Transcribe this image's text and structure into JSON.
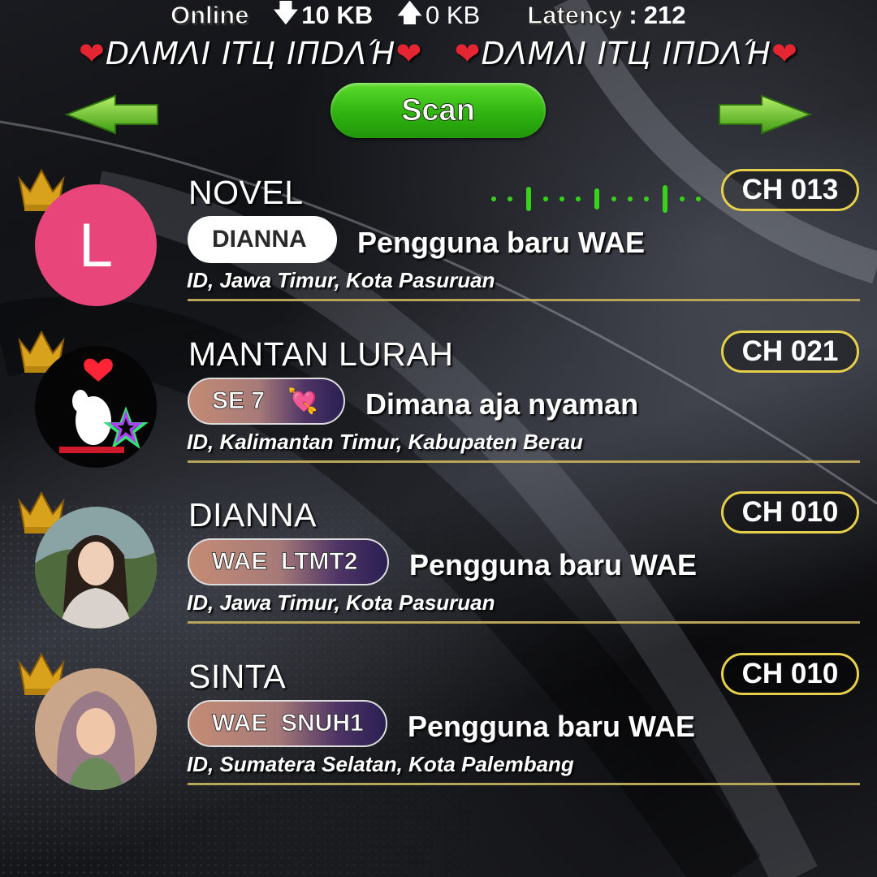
{
  "stats": {
    "online_label": "Online",
    "download_value": "10 KB",
    "upload_value": "0 KB",
    "latency_label": "Latency",
    "latency_value": "212"
  },
  "banner": {
    "text1": "DΛMΛI ITЦ IПDΛΉ",
    "text2": "DΛMΛI ITЦ IПDΛΉ"
  },
  "nav": {
    "scan_label": "Scan"
  },
  "users": [
    {
      "name": "NOVEL",
      "tag": "DIANNA",
      "status": "Pengguna baru WAE",
      "location": "ID, Jawa Timur, Kota Pasuruan",
      "channel": "CH 013",
      "avatar_letter": "L"
    },
    {
      "name": "MANTAN LURAH",
      "tag": "SE 7",
      "status": "Dimana aja nyaman",
      "location": "ID, Kalimantan Timur, Kabupaten Berau",
      "channel": "CH 021"
    },
    {
      "name": "DIANNA",
      "tag": "WAE  LTMT2",
      "status": "Pengguna baru WAE",
      "location": "ID, Jawa Timur, Kota Pasuruan",
      "channel": "CH 010"
    },
    {
      "name": "SINTA",
      "tag": "WAE  SNUH1",
      "status": "Pengguna baru WAE",
      "location": "ID, Sumatera Selatan, Kota Palembang",
      "channel": "CH 010"
    }
  ],
  "colors": {
    "accent_green": "#2fb410",
    "channel_border": "#e6cf4b",
    "divider": "#b9a557",
    "heart": "#e52632",
    "avatar_pink": "#e8457a"
  }
}
